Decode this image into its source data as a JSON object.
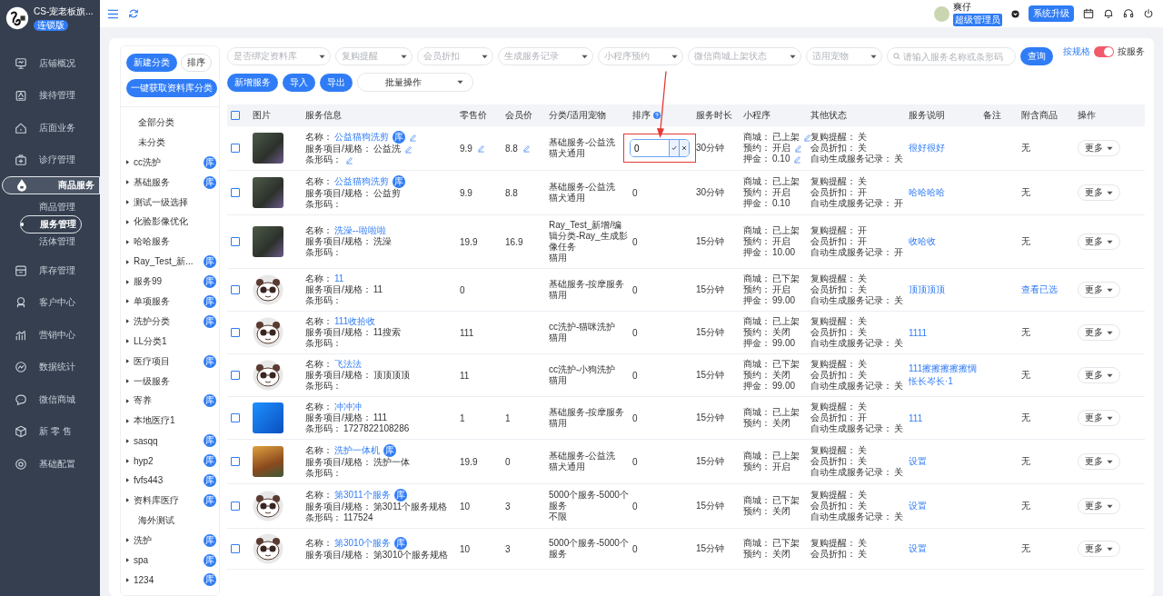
{
  "sidebar": {
    "store_name": "CS-宠老板旗...",
    "edition": "连锁版",
    "nav": [
      {
        "label": "店铺概况",
        "selected": false
      },
      {
        "label": "接待管理",
        "selected": false
      },
      {
        "label": "店面业务",
        "selected": false
      },
      {
        "label": "诊疗管理",
        "selected": false
      },
      {
        "label": "商品服务",
        "selected": true,
        "children": [
          {
            "label": "商品管理",
            "selected": false
          },
          {
            "label": "服务管理",
            "selected": true
          },
          {
            "label": "活体管理",
            "selected": false
          }
        ]
      },
      {
        "label": "库存管理",
        "selected": false
      },
      {
        "label": "客户中心",
        "selected": false
      },
      {
        "label": "营销中心",
        "selected": false
      },
      {
        "label": "数据统计",
        "selected": false
      },
      {
        "label": "微信商城",
        "selected": false
      },
      {
        "label": "新 零 售",
        "selected": false
      },
      {
        "label": "基础配置",
        "selected": false
      }
    ]
  },
  "topbar": {
    "user_name": "爽仔",
    "role": "超级管理员",
    "upgrade_button": "系统升级"
  },
  "categories": {
    "buttons": [
      {
        "label": "新建分类",
        "kind": "primary"
      },
      {
        "label": "排序",
        "kind": "plain"
      }
    ],
    "fetch_button": "一键获取资料库分类",
    "items": [
      {
        "label": "全部分类",
        "expandable": false
      },
      {
        "label": "未分类",
        "expandable": false
      },
      {
        "label": "cc洗护",
        "expandable": true,
        "badge": "库"
      },
      {
        "label": "基础服务",
        "expandable": true,
        "badge": "库"
      },
      {
        "label": "测试一级选择",
        "expandable": true
      },
      {
        "label": "化验影像优化",
        "expandable": true
      },
      {
        "label": "哈哈服务",
        "expandable": true
      },
      {
        "label": "Ray_Test_新...",
        "expandable": true,
        "badge": "库"
      },
      {
        "label": "服务99",
        "expandable": true,
        "badge": "库"
      },
      {
        "label": "单项服务",
        "expandable": true,
        "badge": "库"
      },
      {
        "label": "洗护分类",
        "expandable": true,
        "badge": "库"
      },
      {
        "label": "LL分类1",
        "expandable": true
      },
      {
        "label": "医疗项目",
        "expandable": true,
        "badge": "库"
      },
      {
        "label": "一级服务",
        "expandable": true
      },
      {
        "label": "寄养",
        "expandable": true,
        "badge": "库"
      },
      {
        "label": "本地医疗1",
        "expandable": true
      },
      {
        "label": "sasqq",
        "expandable": true,
        "badge": "库"
      },
      {
        "label": "hyp2",
        "expandable": true,
        "badge": "库"
      },
      {
        "label": "fvfs443",
        "expandable": true,
        "badge": "库"
      },
      {
        "label": "资料库医疗",
        "expandable": true,
        "badge": "库"
      },
      {
        "label": "海外测试",
        "expandable": false
      },
      {
        "label": "洗护",
        "expandable": true,
        "badge": "库"
      },
      {
        "label": "spa",
        "expandable": true,
        "badge": "库"
      },
      {
        "label": "1234",
        "expandable": true,
        "badge": "库"
      }
    ]
  },
  "filters": {
    "selects": [
      "是否绑定资料库",
      "复购提醒",
      "会员折扣",
      "生成服务记录",
      "小程序预约",
      "微信商城上架状态",
      "适用宠物"
    ],
    "search_placeholder": "请输入服务名称或条形码",
    "query_button": "查询"
  },
  "view_toggle": {
    "left": "按规格",
    "right": "按服务",
    "on": true
  },
  "actions": {
    "buttons": [
      {
        "label": "新增服务"
      },
      {
        "label": "导入"
      },
      {
        "label": "导出"
      }
    ],
    "batch": "批量操作"
  },
  "table": {
    "select_all": {
      "checked": false
    },
    "columns": [
      {
        "label": "图片"
      },
      {
        "label": "服务信息"
      },
      {
        "label": "零售价"
      },
      {
        "label": "会员价"
      },
      {
        "label": "分类/适用宠物"
      },
      {
        "label": "排序",
        "help": true
      },
      {
        "label": "服务时长"
      },
      {
        "label": "小程序"
      },
      {
        "label": "其他状态"
      },
      {
        "label": "服务说明"
      },
      {
        "label": "备注"
      },
      {
        "label": "附含商品"
      },
      {
        "label": "操作"
      }
    ],
    "rows": [
      {
        "checked": false,
        "kind": "photo",
        "editable": true,
        "editing": true,
        "info": [
          {
            "label": "名称：",
            "value": "公益猫狗洗剪",
            "badge": "库"
          },
          {
            "label": "服务项目/规格：",
            "value": "公益洗"
          },
          {
            "label": "条形码："
          }
        ],
        "retail": "9.9",
        "member": "8.8",
        "category": "基础服务-公益洗",
        "pets": "猫犬通用",
        "sort": "0",
        "duration": "30分钟",
        "mini": [
          {
            "label": "商城：",
            "value": "已上架"
          },
          {
            "label": "预约：",
            "value": "开启"
          },
          {
            "label": "押金：",
            "value": "0.10"
          }
        ],
        "other": [
          {
            "label": "复购提醒：",
            "value": "关"
          },
          {
            "label": "会员折扣：",
            "value": "关"
          },
          {
            "label": "自动生成服务记录：",
            "value": "关"
          }
        ],
        "description": "很好很好",
        "attached": {
          "text": "无",
          "link": false
        },
        "action": "更多"
      },
      {
        "checked": false,
        "kind": "photo",
        "editable": false,
        "editing": false,
        "info": [
          {
            "label": "名称：",
            "value": "公益猫狗洗剪",
            "badge": "库"
          },
          {
            "label": "服务项目/规格：",
            "value": "公益剪"
          },
          {
            "label": "条形码："
          }
        ],
        "retail": "9.9",
        "member": "8.8",
        "category": "基础服务-公益洗",
        "pets": "猫犬通用",
        "sort": "0",
        "duration": "30分钟",
        "mini": [
          {
            "label": "商城：",
            "value": "已上架"
          },
          {
            "label": "预约：",
            "value": "开启"
          },
          {
            "label": "押金：",
            "value": "0.10"
          }
        ],
        "other": [
          {
            "label": "复购提醒：",
            "value": "关"
          },
          {
            "label": "会员折扣：",
            "value": "开"
          },
          {
            "label": "自动生成服务记录：",
            "value": "开"
          }
        ],
        "description": "哈哈哈哈",
        "attached": {
          "text": "无",
          "link": false
        },
        "action": "更多"
      },
      {
        "checked": false,
        "kind": "photo",
        "editable": false,
        "editing": false,
        "info": [
          {
            "label": "名称：",
            "value": "洗澡--啦啦啦"
          },
          {
            "label": "服务项目/规格：",
            "value": "洗澡"
          },
          {
            "label": "条形码："
          }
        ],
        "retail": "19.9",
        "member": "16.9",
        "category": "Ray_Test_新增/编辑分类-Ray_生成影像任务",
        "pets": "猫用",
        "sort": "0",
        "duration": "15分钟",
        "mini": [
          {
            "label": "商城：",
            "value": "已上架"
          },
          {
            "label": "预约：",
            "value": "开启"
          },
          {
            "label": "押金：",
            "value": "10.00"
          }
        ],
        "other": [
          {
            "label": "复购提醒：",
            "value": "开"
          },
          {
            "label": "会员折扣：",
            "value": "开"
          },
          {
            "label": "自动生成服务记录：",
            "value": "开"
          }
        ],
        "description": "收哈收",
        "attached": {
          "text": "无",
          "link": false
        },
        "action": "更多"
      },
      {
        "checked": false,
        "kind": "avatar",
        "editable": false,
        "editing": false,
        "info": [
          {
            "label": "名称：",
            "value": "11"
          },
          {
            "label": "服务项目/规格：",
            "value": "11"
          },
          {
            "label": "条形码："
          }
        ],
        "retail": "0",
        "category": "基础服务-按摩服务",
        "pets": "猫用",
        "sort": "0",
        "duration": "15分钟",
        "mini": [
          {
            "label": "商城：",
            "value": "已下架"
          },
          {
            "label": "预约：",
            "value": "开启"
          },
          {
            "label": "押金：",
            "value": "99.00"
          }
        ],
        "other": [
          {
            "label": "复购提醒：",
            "value": "关"
          },
          {
            "label": "会员折扣：",
            "value": "关"
          },
          {
            "label": "自动生成服务记录：",
            "value": "关"
          }
        ],
        "description": "顶顶顶顶",
        "attached": {
          "text": "查看已选",
          "link": true
        },
        "action": "更多"
      },
      {
        "checked": false,
        "kind": "avatar",
        "editable": false,
        "editing": false,
        "info": [
          {
            "label": "名称：",
            "value": "111收拾收"
          },
          {
            "label": "服务项目/规格：",
            "value": "11搜索"
          },
          {
            "label": "条形码："
          }
        ],
        "retail": "111",
        "category": "cc洗护-猫咪洗护",
        "pets": "猫用",
        "sort": "0",
        "duration": "15分钟",
        "mini": [
          {
            "label": "商城：",
            "value": "已上架"
          },
          {
            "label": "预约：",
            "value": "关闭"
          },
          {
            "label": "押金：",
            "value": "99.00"
          }
        ],
        "other": [
          {
            "label": "复购提醒：",
            "value": "关"
          },
          {
            "label": "会员折扣：",
            "value": "关"
          },
          {
            "label": "自动生成服务记录：",
            "value": "关"
          }
        ],
        "description": "1111",
        "attached": {
          "text": "无",
          "link": false
        },
        "action": "更多"
      },
      {
        "checked": false,
        "kind": "avatar",
        "editable": false,
        "editing": false,
        "info": [
          {
            "label": "名称：",
            "value": "飞法法"
          },
          {
            "label": "服务项目/规格：",
            "value": "顶顶顶顶"
          },
          {
            "label": "条形码："
          }
        ],
        "retail": "11",
        "category": "cc洗护-小狗洗护",
        "pets": "猫用",
        "sort": "0",
        "duration": "15分钟",
        "mini": [
          {
            "label": "商城：",
            "value": "已下架"
          },
          {
            "label": "预约：",
            "value": "关闭"
          },
          {
            "label": "押金：",
            "value": "99.00"
          }
        ],
        "other": [
          {
            "label": "复购提醒：",
            "value": "关"
          },
          {
            "label": "会员折扣：",
            "value": "关"
          },
          {
            "label": "自动生成服务记录：",
            "value": "关"
          }
        ],
        "description": "111擦擦擦擦擦惆怅长岑长·1",
        "attached": {
          "text": "无",
          "link": false
        },
        "action": "更多"
      },
      {
        "checked": false,
        "kind": "photo",
        "editable": false,
        "editing": false,
        "info": [
          {
            "label": "名称：",
            "value": "冲冲冲"
          },
          {
            "label": "服务项目/规格：",
            "value": "111"
          },
          {
            "label": "条形码：",
            "value": "1727822108286"
          }
        ],
        "retail": "1",
        "member": "1",
        "category": "基础服务-按摩服务",
        "pets": "猫用",
        "sort": "0",
        "duration": "15分钟",
        "mini": [
          {
            "label": "商城：",
            "value": "已上架"
          },
          {
            "label": "预约：",
            "value": "关闭"
          }
        ],
        "other": [
          {
            "label": "复购提醒：",
            "value": "关"
          },
          {
            "label": "会员折扣：",
            "value": "开"
          },
          {
            "label": "自动生成服务记录：",
            "value": "关"
          }
        ],
        "description": "111",
        "attached": {
          "text": "无",
          "link": false
        },
        "action": "更多"
      },
      {
        "checked": false,
        "kind": "photo",
        "editable": false,
        "editing": false,
        "info": [
          {
            "label": "名称：",
            "value": "洗护一体机",
            "badge": "库"
          },
          {
            "label": "服务项目/规格：",
            "value": "洗护一体"
          },
          {
            "label": "条形码："
          }
        ],
        "retail": "19.9",
        "member": "0",
        "category": "基础服务-公益洗",
        "pets": "猫犬通用",
        "sort": "0",
        "duration": "15分钟",
        "mini": [
          {
            "label": "商城：",
            "value": "已上架"
          },
          {
            "label": "预约：",
            "value": "开启"
          }
        ],
        "other": [
          {
            "label": "复购提醒：",
            "value": "关"
          },
          {
            "label": "会员折扣：",
            "value": "关"
          },
          {
            "label": "自动生成服务记录：",
            "value": "关"
          }
        ],
        "description": "设置",
        "attached": {
          "text": "无",
          "link": false
        },
        "action": "更多"
      },
      {
        "checked": false,
        "kind": "avatar",
        "editable": false,
        "editing": false,
        "info": [
          {
            "label": "名称：",
            "value": "第3011个服务",
            "badge": "库"
          },
          {
            "label": "服务项目/规格：",
            "value": "第3011个服务规格"
          },
          {
            "label": "条形码：",
            "value": "117524"
          }
        ],
        "retail": "10",
        "member": "3",
        "category": "5000个服务-5000个服务",
        "pets": "不限",
        "sort": "0",
        "duration": "15分钟",
        "mini": [
          {
            "label": "商城：",
            "value": "已下架"
          },
          {
            "label": "预约：",
            "value": "关闭"
          }
        ],
        "other": [
          {
            "label": "复购提醒：",
            "value": "关"
          },
          {
            "label": "会员折扣：",
            "value": "关"
          },
          {
            "label": "自动生成服务记录：",
            "value": "关"
          }
        ],
        "description": "设置",
        "attached": {
          "text": "无",
          "link": false
        },
        "action": "更多"
      },
      {
        "checked": false,
        "kind": "avatar",
        "editable": false,
        "editing": false,
        "info": [
          {
            "label": "名称：",
            "value": "第3010个服务",
            "badge": "库"
          },
          {
            "label": "服务项目/规格：",
            "value": "第3010个服务规格"
          }
        ],
        "retail": "10",
        "member": "3",
        "category": "5000个服务-5000个服务",
        "sort": "0",
        "duration": "15分钟",
        "mini": [
          {
            "label": "商城：",
            "value": "已下架"
          },
          {
            "label": "预约：",
            "value": "关闭"
          }
        ],
        "other": [
          {
            "label": "复购提醒：",
            "value": "关"
          },
          {
            "label": "会员折扣：",
            "value": "关"
          }
        ],
        "description": "设置",
        "attached": {
          "text": "无",
          "link": false
        },
        "action": "更多"
      }
    ]
  }
}
